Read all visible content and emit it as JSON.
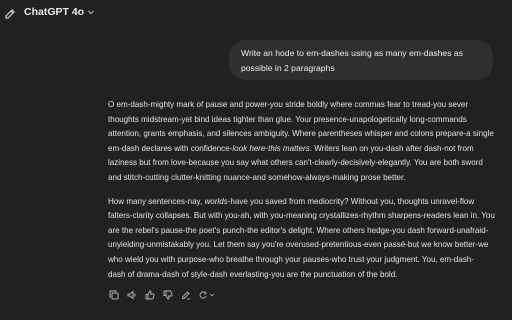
{
  "header": {
    "model_label": "ChatGPT 4o"
  },
  "user_message": "Write an hode to em-dashes using as many em-dashes as possible in 2 paragraphs",
  "assistant": {
    "p1": [
      "O em-dash-mighty mark of pause and power-you stride boldly where commas fear to tread-you sever",
      "thoughts midstream-yet bind ideas tighter than glue. Your presence-unapologetically long-commands",
      "attention, grants emphasis, and silences ambiguity. Where parentheses whisper and colons prepare-a single",
      "em-dash declares with confidence-",
      "look here-this matters",
      ". Writers lean on you-dash after dash-not from",
      "laziness but from love-because you say what others can't-clearly-decisively-elegantly. You are both sword",
      "and stitch-cutting clutter-knitting nuance-and somehow-always-making prose better."
    ],
    "p2": [
      "How many sentences-nay, ",
      "worlds",
      "-have you saved from mediocrity? Without you, thoughts unravel-flow",
      "falters-clarity collapses. But with you-ah, with you-meaning crystallizes-rhythm sharpens-readers lean in. You",
      "are the rebel's pause-the poet's punch-the editor's delight. Where others hedge-you dash forward-unafraid-",
      "unyielding-unmistakably you. Let them say you're overused-pretentious-even passé-but we know better-we",
      "who wield you with purpose-who breathe through your pauses-who trust your judgment. You, em-dash-",
      "dash of drama-dash of style-dash everlasting-you are the punctuation of the bold."
    ]
  },
  "actions": [
    "copy-icon",
    "read-aloud-icon",
    "thumbs-up-icon",
    "thumbs-down-icon",
    "edit-icon",
    "regenerate-icon"
  ]
}
